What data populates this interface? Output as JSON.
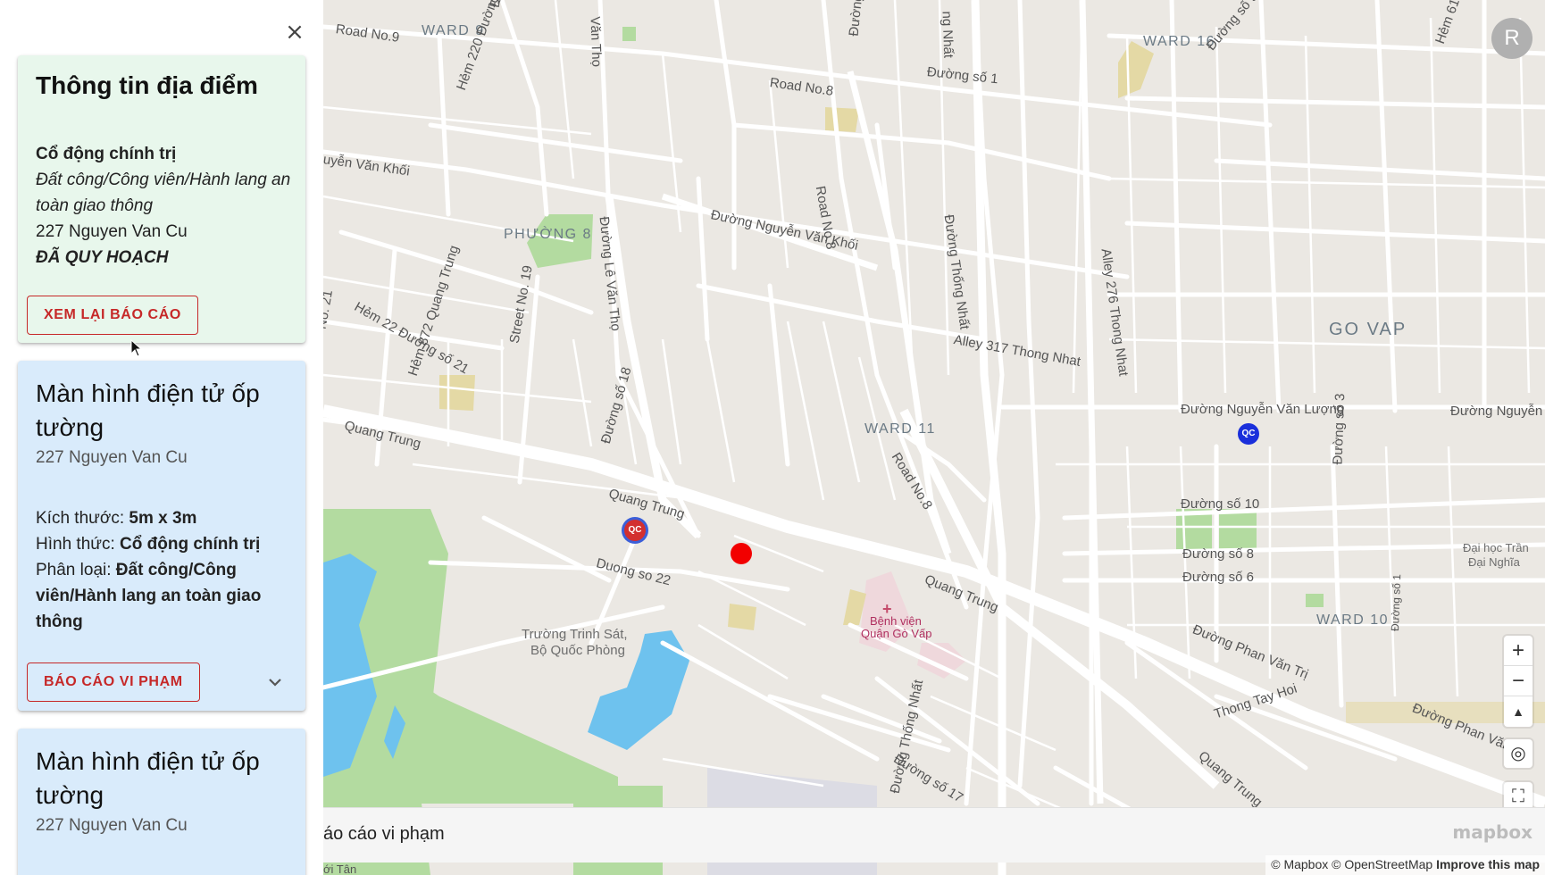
{
  "sidebar": {
    "close_label": "×",
    "info_card": {
      "title": "Thông tin địa điểm",
      "ad_type": "Cổ động chính trị",
      "location_type": "Đất công/Công viên/Hành lang an toàn giao thông",
      "address": "227 Nguyen Van Cu",
      "status": "ĐÃ QUY HOẠCH",
      "button_label": "XEM LẠI BÁO CÁO"
    },
    "ad_cards": [
      {
        "title": "Màn hình điện tử ốp tường",
        "address": "227 Nguyen Van Cu",
        "size_label": "Kích thước: ",
        "size_value": "5m x 3m",
        "form_label": "Hình thức: ",
        "form_value": "Cổ động chính trị",
        "category_label": "Phân loại: ",
        "category_value": "Đất công/Công viên/Hành lang an toàn giao thông",
        "button_label": "BÁO CÁO VI PHẠM"
      },
      {
        "title": "Màn hình điện tử ốp tường",
        "address": "227 Nguyen Van Cu"
      }
    ]
  },
  "map": {
    "labels": {
      "ward9": "WARD 9",
      "ward16": "WARD 16",
      "ward11": "WARD 11",
      "ward10": "WARD 10",
      "phuong8": "PHƯỜNG 8",
      "govap": "GO VAP",
      "road8a": "Road No.8",
      "road8b": "Road No.8",
      "road8c": "Road No.8",
      "road9": "Road No.9",
      "duongso1": "Đường số 1",
      "duongso10": "Đường số 10",
      "duongso8": "Đường số 8",
      "duongso6": "Đường số 6",
      "duongso22": "Duong so 22",
      "duongso18": "Đường số 18",
      "duongso17": "Đường số 17",
      "nguyenvankhoi": "Đường Nguyễn Văn Khối",
      "uyenvankhoi": "uyễn Văn Khối",
      "levantho": "Đường Lê Văn Thọ",
      "vantho": "Văn Thọ",
      "thongnhat": "Đường Thống Nhất",
      "thongnhat2": "Đường Thống Nhất",
      "ngnhat": "ng Nhất",
      "nguyenvanluong": "Đường Nguyễn Văn Lượng",
      "nguyenv": "Đường Nguyễn V",
      "quangtrung1": "Quang Trung",
      "quangtrung2": "Quang Trung",
      "quangtrung3": "Quang Trung",
      "quangtrung4": "Quang Trung",
      "phanvantri": "Đường Phan Văn Trị",
      "phanvantri2": "Đường Phan Văn Tr",
      "alley317": "Alley 317 Thong Nhat",
      "alley276": "Alley 276 Thong Nhat",
      "hem22": "Hẻm 22 Đường số 21",
      "hem872": "Hẻm 872 Quang Trung",
      "hem220": "Hẻm 220 Đường số 10",
      "street19": "Street No. 19",
      "thongtayhoi": "Thong Tay Hoi",
      "truongtrinhsat": "Trường Trinh Sát,",
      "boquocphong": "Bộ Quốc Phòng",
      "benhvien": "Bệnh viện",
      "quangovap": "Quận Gò Vấp",
      "daihoc1": "Đại học Trần",
      "daihoc2": "Đại Nghĩa",
      "duongso3": "Đường số 3",
      "duongso9": "Đường số 9",
      "hem614": "Hẻm 614",
      "duongso2": "Đường số 2",
      "duongso1b": "Đường số 1",
      "no21": "No. 21",
      "duongsi": "Đường số",
      "dtan": "ới Tân"
    },
    "qc_label": "QC",
    "avatar_letter": "R",
    "zoom_in": "+",
    "zoom_out": "−",
    "compass": "▲",
    "locate": "◎",
    "fullscreen": "⛶",
    "report_bar_text": "áo cáo vi phạm",
    "mapbox_logo": "mapbox",
    "attribution": "© Mapbox © OpenStreetMap",
    "improve": "Improve this map"
  }
}
